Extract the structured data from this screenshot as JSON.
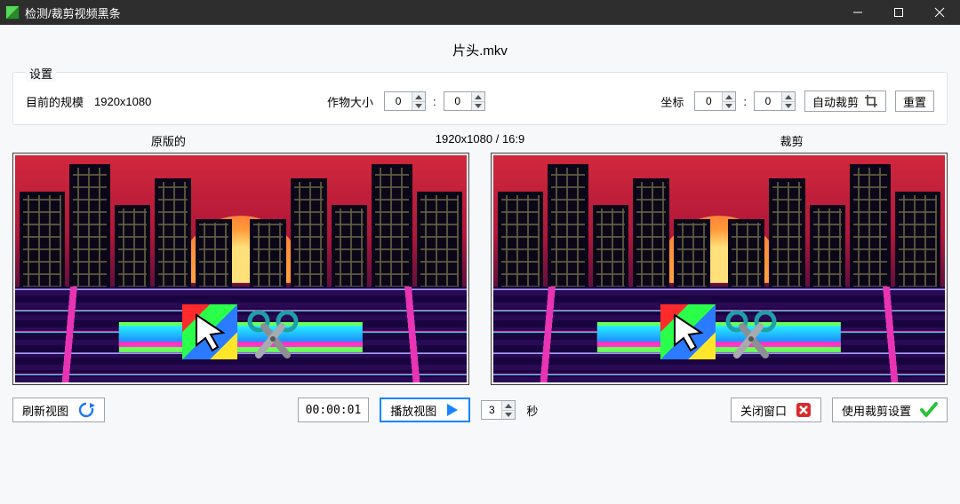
{
  "window": {
    "title": "检测/裁剪视频黑条"
  },
  "file": {
    "name": "片头.mkv"
  },
  "settings": {
    "legend": "设置",
    "current_scale_label": "目前的规模",
    "current_scale_value": "1920x1080",
    "crop_size_label": "作物大小",
    "crop_w": "0",
    "crop_h": "0",
    "coord_label": "坐标",
    "coord_x": "0",
    "coord_y": "0",
    "auto_crop_label": "自动裁剪",
    "reset_label": "重置",
    "colon": ":"
  },
  "headers": {
    "original": "原版的",
    "aspect_info": "1920x1080 / 16:9",
    "cropped": "裁剪"
  },
  "bottom": {
    "refresh_label": "刷新视图",
    "timecode": "00:00:01",
    "play_view_label": "播放视图",
    "seconds_value": "3",
    "seconds_unit": "秒",
    "close_label": "关闭窗口",
    "apply_label": "使用裁剪设置"
  }
}
